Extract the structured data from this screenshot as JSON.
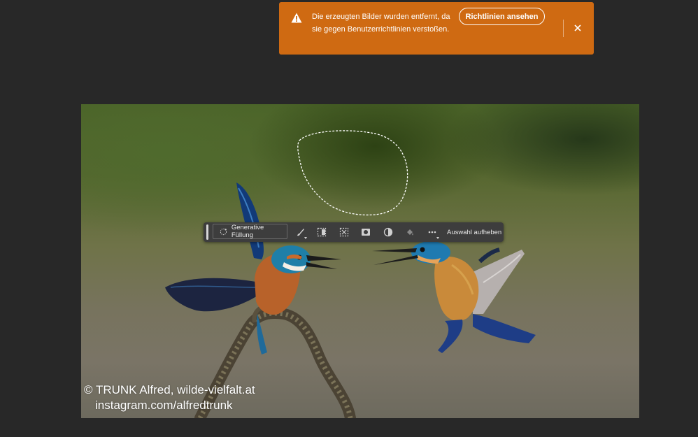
{
  "toast": {
    "message": "Die erzeugten Bilder wurden entfernt, da sie gegen Benutzerrichtlinien verstoßen.",
    "action_label": "Richtlinien ansehen",
    "background": "#cf6a12"
  },
  "taskbar": {
    "generative_fill_label": "Generative Füllung",
    "deselect_label": "Auswahl aufheben",
    "tools": [
      "brush-icon",
      "select-subject-icon",
      "transform-selection-icon",
      "mask-icon",
      "adjustment-icon",
      "fill-bucket-icon",
      "more-icon"
    ]
  },
  "canvas": {
    "watermark_line1": "© TRUNK Alfred, wilde-vielfalt.at",
    "watermark_line2": "instagram.com/alfredtrunk"
  }
}
